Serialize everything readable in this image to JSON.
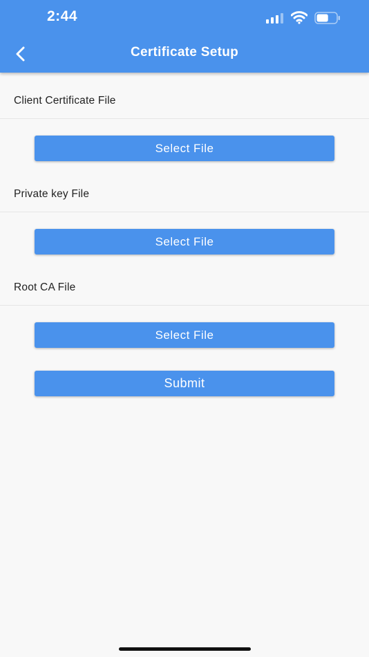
{
  "status_bar": {
    "time": "2:44",
    "signal_icon": "cellular-signal-icon",
    "wifi_icon": "wifi-icon",
    "battery_icon": "battery-icon",
    "battery_level": 0.6
  },
  "header": {
    "title": "Certificate Setup",
    "back_icon": "chevron-left-icon"
  },
  "sections": [
    {
      "label": "Client Certificate File",
      "button_label": "Select File"
    },
    {
      "label": "Private key File",
      "button_label": "Select File"
    },
    {
      "label": "Root CA File",
      "button_label": "Select File"
    }
  ],
  "submit_label": "Submit",
  "colors": {
    "primary": "#4a92ec",
    "background": "#f8f8f8",
    "text": "#222222"
  }
}
